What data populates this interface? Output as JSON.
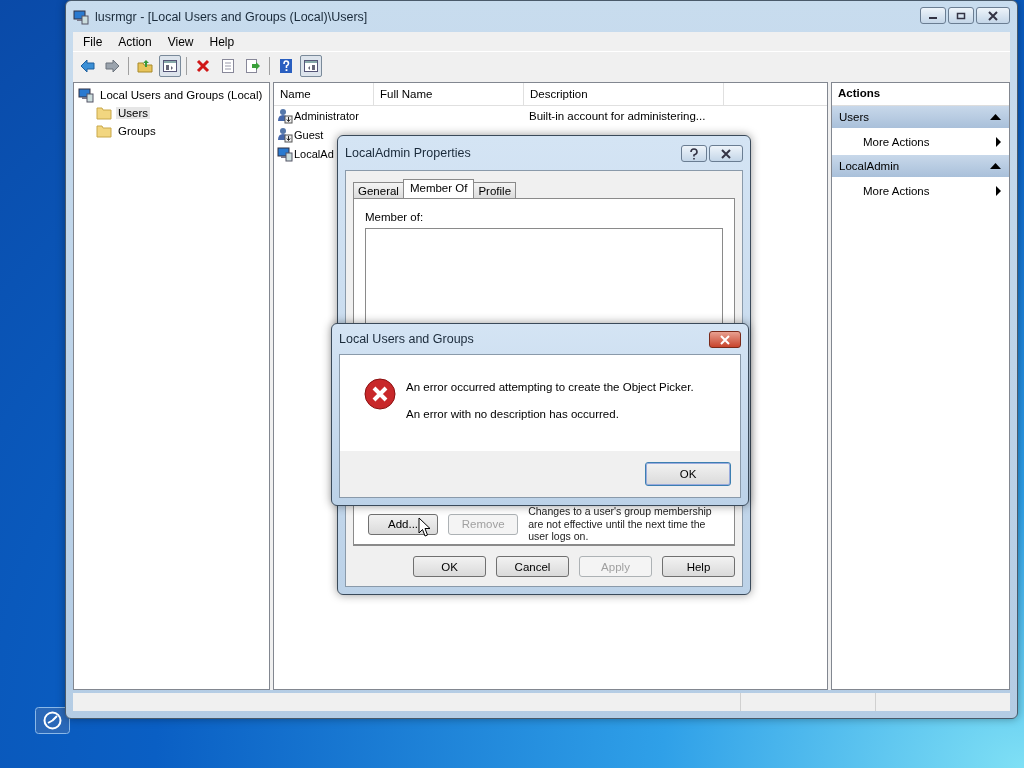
{
  "window": {
    "title": "lusrmgr - [Local Users and Groups (Local)\\Users]"
  },
  "menu": [
    "File",
    "Action",
    "View",
    "Help"
  ],
  "toolbar": [
    {
      "kind": "back"
    },
    {
      "kind": "forward"
    },
    {
      "kind": "separator"
    },
    {
      "kind": "up"
    },
    {
      "kind": "tree-toggle",
      "pressed": true
    },
    {
      "kind": "separator"
    },
    {
      "kind": "delete"
    },
    {
      "kind": "properties"
    },
    {
      "kind": "export"
    },
    {
      "kind": "separator"
    },
    {
      "kind": "help"
    },
    {
      "kind": "pane-toggle",
      "pressed": true
    }
  ],
  "tree": [
    {
      "label": "Local Users and Groups (Local)",
      "selected": false,
      "children": [
        {
          "label": "Users",
          "selected": true
        },
        {
          "label": "Groups",
          "selected": false
        }
      ]
    }
  ],
  "table": {
    "columns": [
      "Name",
      "Full Name",
      "Description"
    ],
    "rows": [
      {
        "name": "Administrator",
        "description": "Built-in account for administering...",
        "kind": "builtin"
      },
      {
        "name": "Guest",
        "kind": "builtin"
      },
      {
        "name": "LocalAd",
        "kind": "user"
      }
    ]
  },
  "actions": {
    "title": "Actions",
    "sections": [
      {
        "title": "Users",
        "items": [
          "More Actions"
        ]
      },
      {
        "title": "LocalAdmin",
        "items": [
          "More Actions"
        ]
      }
    ]
  },
  "properties_dialog": {
    "title": "LocalAdmin Properties",
    "tabs": [
      {
        "label": "General",
        "selected": false
      },
      {
        "label": "Member Of",
        "selected": true
      },
      {
        "label": "Profile",
        "selected": false
      }
    ],
    "member_of_label": "Member of:",
    "list_buttons": [
      {
        "label": "Add...",
        "disabled": false
      },
      {
        "label": "Remove",
        "disabled": true
      }
    ],
    "note": "Changes to a user's group membership are not effective until the next time the user logs on.",
    "buttons": [
      {
        "label": "OK",
        "disabled": false
      },
      {
        "label": "Cancel",
        "disabled": false
      },
      {
        "label": "Apply",
        "disabled": true
      },
      {
        "label": "Help",
        "disabled": false
      }
    ]
  },
  "error_dialog": {
    "title": "Local Users and Groups",
    "messages": [
      "An error occurred attempting to create the Object Picker.",
      "An error with no description has occurred."
    ],
    "button": "OK"
  }
}
